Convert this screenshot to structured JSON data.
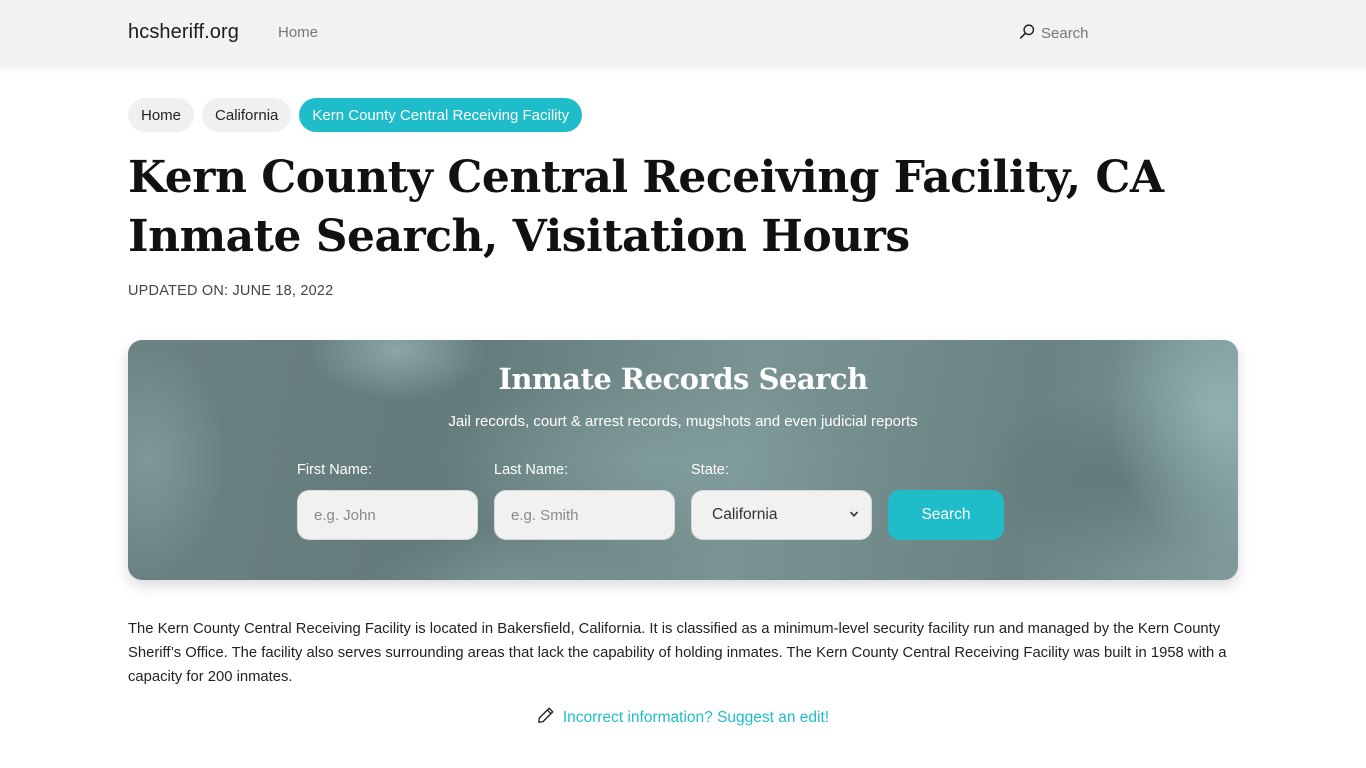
{
  "navbar": {
    "brand": "hcsheriff.org",
    "links": [
      {
        "label": "Home"
      }
    ],
    "search_label": "Search",
    "search_icon": "search-icon"
  },
  "breadcrumb": [
    {
      "label": "Home",
      "active": false
    },
    {
      "label": "California",
      "active": false
    },
    {
      "label": "Kern County Central Receiving Facility",
      "active": true
    }
  ],
  "page": {
    "title_line1": "Kern County Central Receiving Facility, CA",
    "title_line2": "Inmate Search, Visitation Hours",
    "updated": "UPDATED ON: JUNE 18, 2022"
  },
  "search_card": {
    "title": "Inmate Records Search",
    "subtitle": "Jail records, court & arrest records, mugshots and even judicial reports",
    "first_name": {
      "label": "First Name:",
      "placeholder": "e.g. John",
      "value": ""
    },
    "last_name": {
      "label": "Last Name:",
      "placeholder": "e.g. Smith",
      "value": ""
    },
    "state": {
      "label": "State:",
      "selected": "California"
    },
    "button_label": "Search"
  },
  "description": "The Kern County Central Receiving Facility is located in Bakersfield, California. It is classified as a minimum-level security facility run and managed by the Kern County Sheriff’s Office. The facility also serves surrounding areas that lack the capability of holding inmates. The Kern County Central Receiving Facility was built in 1958 with a capacity for 200 inmates.",
  "suggest_edit": {
    "icon": "pencil-icon",
    "label": "Incorrect information? Suggest an edit!"
  },
  "colors": {
    "accent": "#1ebdc9",
    "navbar_bg": "#f2f2f2",
    "crumb_bg": "#f0f0f0"
  }
}
